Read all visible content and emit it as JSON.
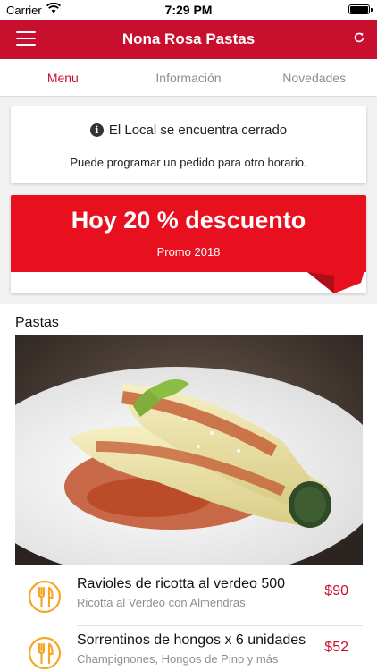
{
  "status_bar": {
    "carrier": "Carrier",
    "time": "7:29 PM"
  },
  "nav": {
    "title": "Nona Rosa Pastas",
    "menu_icon": "hamburger-menu-icon",
    "refresh_icon": "refresh-icon"
  },
  "tabs": [
    {
      "label": "Menu",
      "active": true
    },
    {
      "label": "Información",
      "active": false
    },
    {
      "label": "Novedades",
      "active": false
    }
  ],
  "notice": {
    "title": "El Local se encuentra cerrado",
    "subtitle": "Puede programar un pedido para otro horario."
  },
  "promo": {
    "title": "Hoy 20 % descuento",
    "subtitle": "Promo 2018"
  },
  "section": {
    "title": "Pastas",
    "image": "cannelloni-dish-photo",
    "items": [
      {
        "name": "Ravioles de ricotta al verdeo 500",
        "description": "Ricotta al Verdeo con Almendras",
        "price": "$90"
      },
      {
        "name": "Sorrentinos de hongos x 6 unidades",
        "description": "Champignones, Hongos de Pino y más",
        "price": "$52"
      }
    ]
  },
  "colors": {
    "brand": "#c8102e",
    "promo": "#e8101e",
    "item_icon": "#f5a623"
  }
}
